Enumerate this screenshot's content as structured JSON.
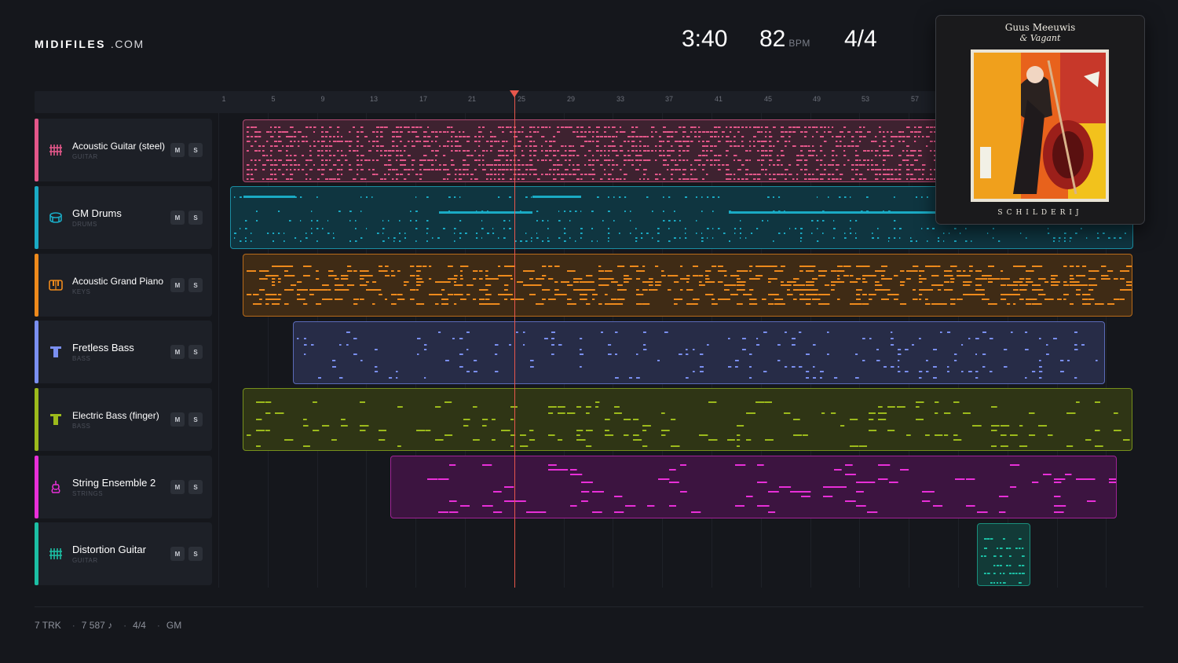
{
  "brand": {
    "name": "MIDIFILES",
    "suffix": ".COM"
  },
  "transport": {
    "duration": "3:40",
    "tempo": "82",
    "tempo_unit": "BPM",
    "time_signature": "4/4"
  },
  "ruler": {
    "ticks": [
      "1",
      "5",
      "9",
      "13",
      "17",
      "21",
      "25",
      "29",
      "33",
      "37",
      "41",
      "45",
      "49",
      "53",
      "57"
    ]
  },
  "tracks": [
    {
      "name": "Acoustic Guitar (steel)",
      "category": "GUITAR",
      "color": "#e4578a",
      "icon": "guitar-grid-icon",
      "mute": "M",
      "solo": "S"
    },
    {
      "name": "GM Drums",
      "category": "DRUMS",
      "color": "#1aaac4",
      "icon": "drum-icon",
      "mute": "M",
      "solo": "S"
    },
    {
      "name": "Acoustic Grand Piano",
      "category": "KEYS",
      "color": "#ee8a1c",
      "icon": "piano-keys-icon",
      "mute": "M",
      "solo": "S"
    },
    {
      "name": "Fretless Bass",
      "category": "BASS",
      "color": "#7a8ff0",
      "icon": "bass-icon",
      "mute": "M",
      "solo": "S"
    },
    {
      "name": "Electric Bass (finger)",
      "category": "BASS",
      "color": "#9cba1c",
      "icon": "bass-icon",
      "mute": "M",
      "solo": "S"
    },
    {
      "name": "String Ensemble 2",
      "category": "STRINGS",
      "color": "#e82fd8",
      "icon": "violin-icon",
      "mute": "M",
      "solo": "S"
    },
    {
      "name": "Distortion Guitar",
      "category": "GUITAR",
      "color": "#1cbfa4",
      "icon": "guitar-grid-icon",
      "mute": "M",
      "solo": "S"
    }
  ],
  "playhead": {
    "bar": 25
  },
  "album": {
    "artist": "Guus Meeuwis",
    "band": "& Vagant",
    "title": "SCHILDERIJ"
  },
  "footer": {
    "tracks": "7 TRK",
    "notes": "7 587 ♪",
    "meter": "4/4",
    "standard": "GM"
  }
}
